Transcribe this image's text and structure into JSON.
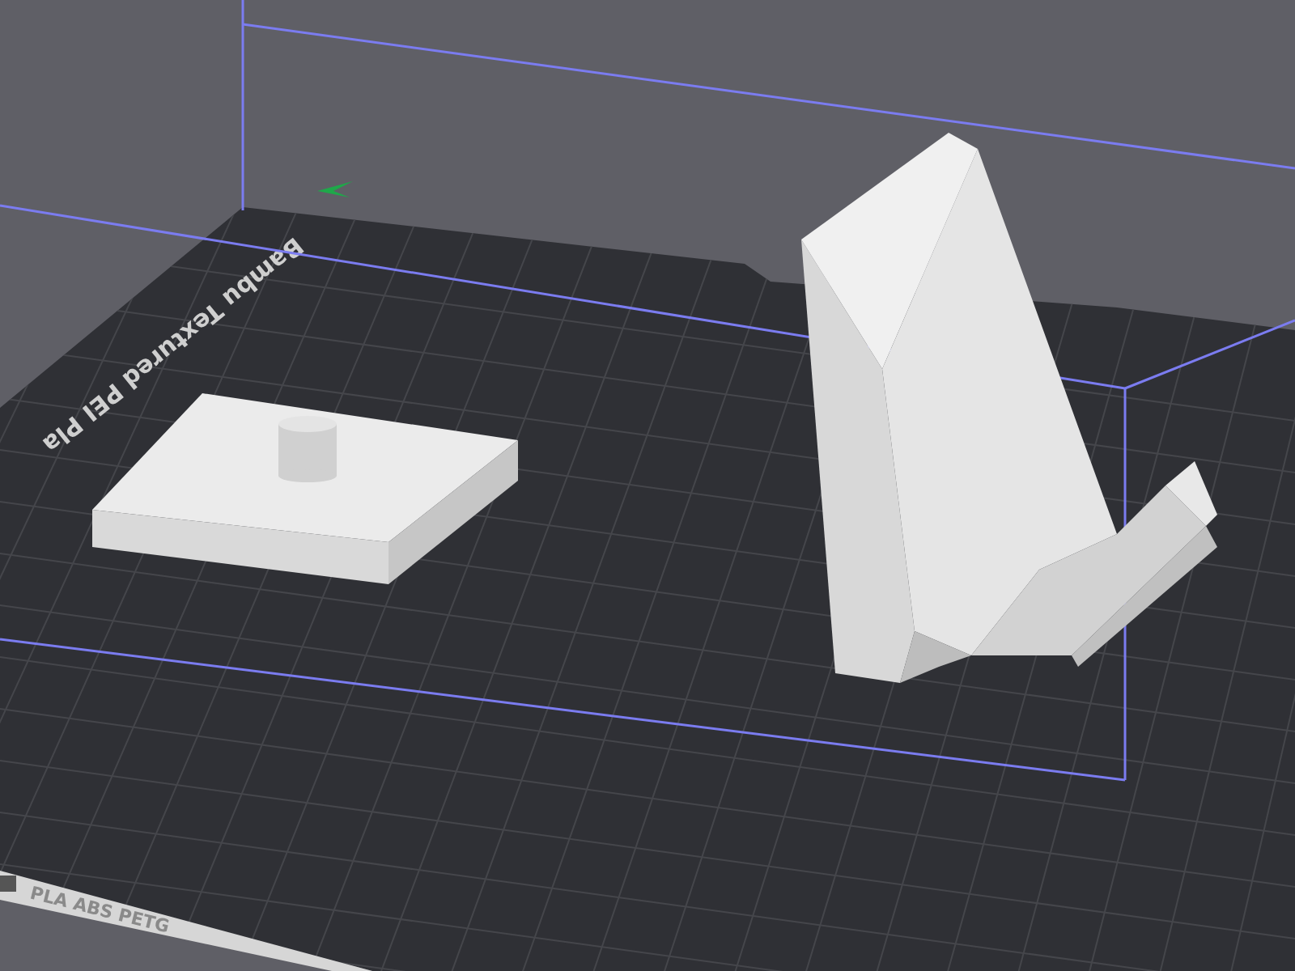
{
  "viewport": {
    "plate_label": "Bambu Textured PEI Pla",
    "filament_label": "PLA ABS PETG"
  }
}
